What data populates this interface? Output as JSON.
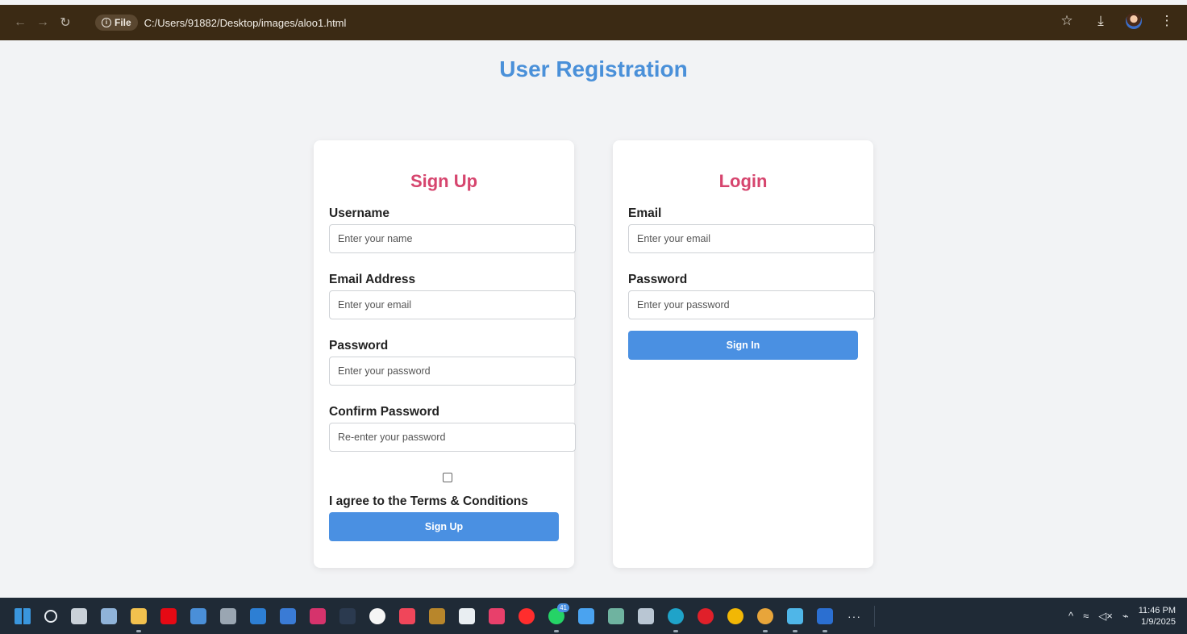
{
  "browser": {
    "back_icon": "←",
    "forward_icon": "→",
    "reload_icon": "↻",
    "file_chip_label": "File",
    "url": "C:/Users/91882/Desktop/images/aloo1.html",
    "star_icon": "☆",
    "download_icon": "⤓",
    "menu_icon": "⋮"
  },
  "page": {
    "title": "User Registration"
  },
  "signup": {
    "title": "Sign Up",
    "username_label": "Username",
    "username_placeholder": "Enter your name",
    "email_label": "Email Address",
    "email_placeholder": "Enter your email",
    "password_label": "Password",
    "password_placeholder": "Enter your password",
    "confirm_label": "Confirm Password",
    "confirm_placeholder": "Re-enter your password",
    "terms_label": "I agree to the Terms & Conditions",
    "button_label": "Sign Up"
  },
  "login": {
    "title": "Login",
    "email_label": "Email",
    "email_placeholder": "Enter your email",
    "password_label": "Password",
    "password_placeholder": "Enter your password",
    "button_label": "Sign In"
  },
  "taskbar": {
    "apps": [
      {
        "name": "start-icon",
        "color": "#3a96dd"
      },
      {
        "name": "search-icon",
        "color": "#1f2a36"
      },
      {
        "name": "task-view-icon",
        "color": "#c9d1d9"
      },
      {
        "name": "settings-icon",
        "color": "#8fb3d9"
      },
      {
        "name": "file-explorer-icon",
        "color": "#f2c14e"
      },
      {
        "name": "netflix-icon",
        "color": "#e50914"
      },
      {
        "name": "photos-icon",
        "color": "#4a8fd8"
      },
      {
        "name": "app-gem-icon",
        "color": "#9aa6b2"
      },
      {
        "name": "vscode-icon",
        "color": "#2d7fd4"
      },
      {
        "name": "calculator-icon",
        "color": "#3a7bd5"
      },
      {
        "name": "instagram-icon",
        "color": "#d6336c"
      },
      {
        "name": "dh-app-icon",
        "color": "#2b3a4f"
      },
      {
        "name": "u-app-icon",
        "color": "#f5f5f5"
      },
      {
        "name": "music-icon",
        "color": "#f0465a"
      },
      {
        "name": "sonyliv-icon",
        "color": "#b8862b"
      },
      {
        "name": "media-icon",
        "color": "#e9eef2"
      },
      {
        "name": "intellij-icon",
        "color": "#e8406b"
      },
      {
        "name": "youtube-icon",
        "color": "#ff2d2d"
      },
      {
        "name": "whatsapp-icon",
        "color": "#25d366"
      },
      {
        "name": "copilot-icon",
        "color": "#4aa3f0"
      },
      {
        "name": "chatgpt-icon",
        "color": "#6fb3a0"
      },
      {
        "name": "paint-icon",
        "color": "#b9c6d3"
      },
      {
        "name": "edge-icon",
        "color": "#1fa3c9"
      },
      {
        "name": "opera-icon",
        "color": "#e0202a"
      },
      {
        "name": "chrome-icon",
        "color": "#f2b705"
      },
      {
        "name": "chrome-profile-icon",
        "color": "#e8a53a"
      },
      {
        "name": "notepad-icon",
        "color": "#4fb6e8"
      },
      {
        "name": "word-icon",
        "color": "#2b6fd1"
      }
    ],
    "more_label": "···",
    "chevron_icon": "^",
    "wifi_icon": "≈",
    "volume_icon": "◁×",
    "battery_icon": "⌁",
    "time": "11:46 PM",
    "date": "1/9/2025",
    "whatsapp_badge": "41"
  }
}
